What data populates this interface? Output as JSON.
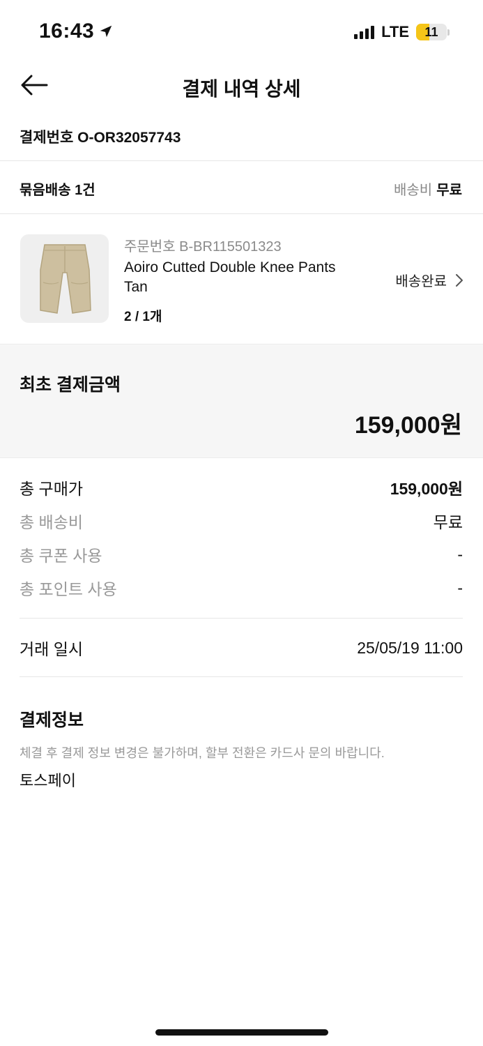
{
  "status_bar": {
    "time": "16:43",
    "network": "LTE",
    "battery": "11",
    "battery_level": 0.11
  },
  "header": {
    "title": "결제 내역 상세",
    "back_icon": "arrow-left-icon"
  },
  "order_no": "결제번호 O-OR32057743",
  "bundle": {
    "label": "묶음배송 1건",
    "shipping_label": "배송비",
    "shipping_value": "무료"
  },
  "product": {
    "order_no": "주문번호 B-BR115501323",
    "name": "Aoiro Cutted Double Knee Pants Tan",
    "quantity": "2 / 1개",
    "status": "배송완료",
    "thumbnail_icon": "pants-icon",
    "thumbnail_color": "#cdbf9f"
  },
  "initial_payment": {
    "label": "최초 결제금액",
    "amount": "159,000원"
  },
  "summary": [
    {
      "key": "총 구매가",
      "value": "159,000원"
    },
    {
      "key": "총 배송비",
      "value": "무료"
    },
    {
      "key": "총 쿠폰 사용",
      "value": "-"
    },
    {
      "key": "총 포인트 사용",
      "value": "-"
    }
  ],
  "transaction": {
    "key": "거래 일시",
    "value": "25/05/19 11:00"
  },
  "payment_info": {
    "title": "결제정보",
    "notice": "체결 후 결제 정보 변경은 불가하며, 할부 전환은 카드사 문의 바랍니다.",
    "method": "토스페이"
  }
}
